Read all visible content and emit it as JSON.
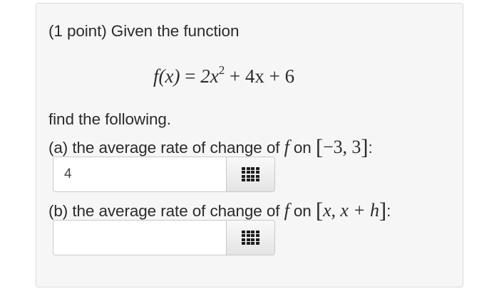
{
  "problem": {
    "intro": "(1 point) Given the function",
    "formula": {
      "lhs": "f(x)",
      "equals": "=",
      "term1": "2x",
      "exp": "2",
      "rest": "+ 4x + 6"
    },
    "find": "find the following."
  },
  "part_a": {
    "prefix": "(a) the average rate of change of",
    "fn": "f",
    "on": "on",
    "interval": "−3, 3",
    "suffix": ":",
    "answer_value": "4",
    "palette_icon": "grid-icon"
  },
  "part_b": {
    "prefix": "(b) the average rate of change of",
    "fn": "f",
    "on": "on",
    "interval": "x, x + h",
    "suffix": ":",
    "answer_value": "",
    "palette_icon": "grid-icon"
  }
}
